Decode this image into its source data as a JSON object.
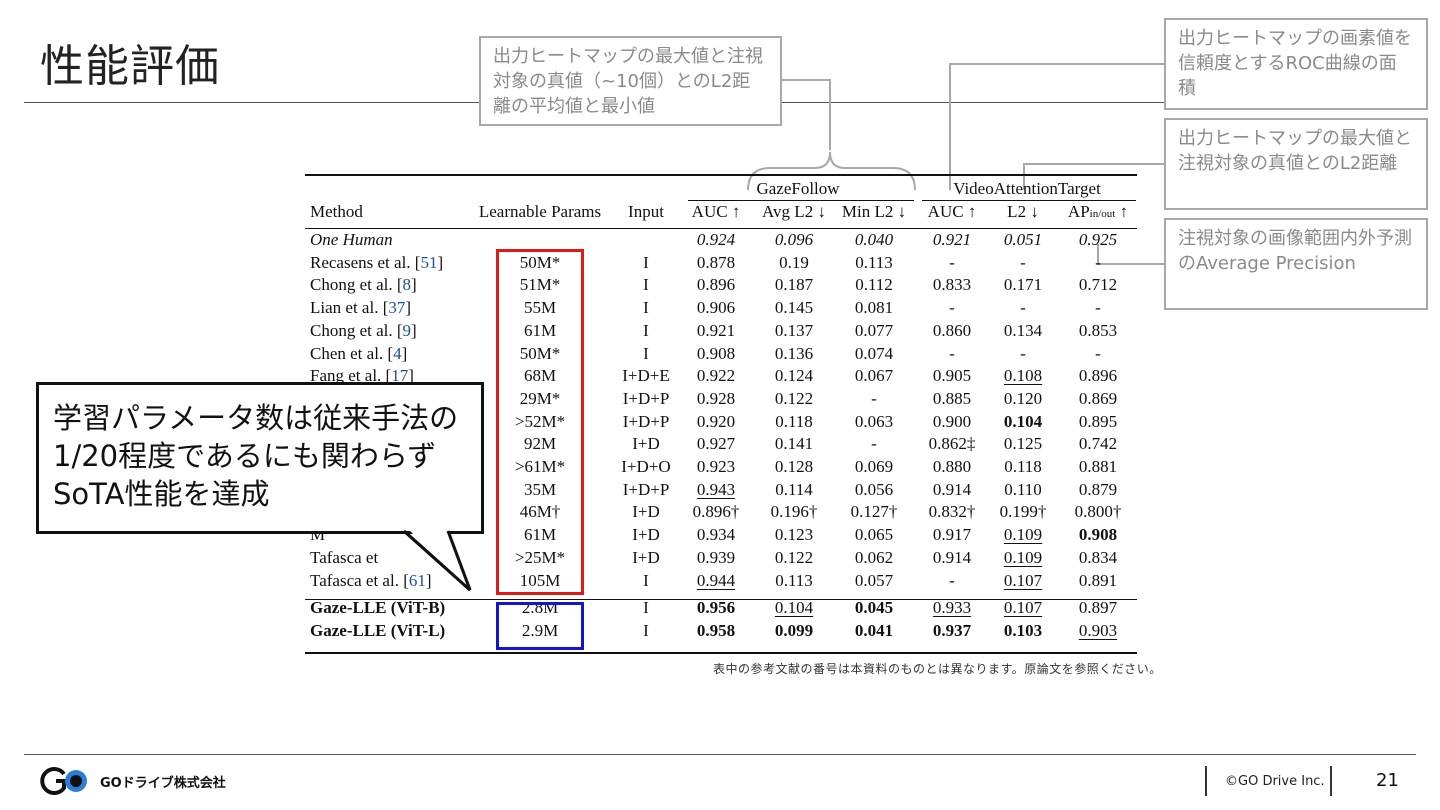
{
  "slide": {
    "title": "性能評価",
    "page_number": "21",
    "copyright": "©GO Drive Inc.",
    "logo_text": "GOドライブ株式会社",
    "note": "表中の参考文献の番号は本資料のものとは異なります。原論文を参照ください。"
  },
  "callouts": {
    "gazefollow_l2": "出力ヒートマップの最大値と注視対象の真値（~10個）とのL2距離の平均値と最小値",
    "auc": "出力ヒートマップの画素値を信頼度とするROC曲線の面積",
    "vat_l2": "出力ヒートマップの最大値と注視対象の真値とのL2距離",
    "ap": "注視対象の画像範囲内外予測のAverage Precision",
    "speech": "学習パラメータ数は従来手法の1/20程度であるにも関わらずSoTA性能を達成"
  },
  "table": {
    "group_gazefollow": "GazeFollow",
    "group_vat": "VideoAttentionTarget",
    "headers": [
      "Method",
      "Learnable Params",
      "Input",
      "AUC ↑",
      "Avg L2 ↓",
      "Min L2 ↓",
      "AUC ↑",
      "L2 ↓",
      "AP"
    ],
    "ap_sub": "in/out",
    "ap_arrow": "↑",
    "rows": [
      {
        "method": "One Human",
        "ref": "",
        "params": "",
        "input": "",
        "v": [
          "0.924",
          "0.096",
          "0.040",
          "0.921",
          "0.051",
          "0.925"
        ],
        "italic": true
      },
      {
        "method": "Recasens et al. [",
        "ref": "51",
        "params": "50M*",
        "input": "I",
        "v": [
          "0.878",
          "0.19",
          "0.113",
          "-",
          "-",
          "-"
        ]
      },
      {
        "method": "Chong et al. [",
        "ref": "8",
        "params": "51M*",
        "input": "I",
        "v": [
          "0.896",
          "0.187",
          "0.112",
          "0.833",
          "0.171",
          "0.712"
        ]
      },
      {
        "method": "Lian et al. [",
        "ref": "37",
        "params": "55M",
        "input": "I",
        "v": [
          "0.906",
          "0.145",
          "0.081",
          "-",
          "-",
          "-"
        ]
      },
      {
        "method": "Chong et al. [",
        "ref": "9",
        "params": "61M",
        "input": "I",
        "v": [
          "0.921",
          "0.137",
          "0.077",
          "0.860",
          "0.134",
          "0.853"
        ]
      },
      {
        "method": "Chen et al. [",
        "ref": "4",
        "params": "50M*",
        "input": "I",
        "v": [
          "0.908",
          "0.136",
          "0.074",
          "-",
          "-",
          "-"
        ]
      },
      {
        "method": "Fang et al. [",
        "ref": "17",
        "params": "68M",
        "input": "I+D+E",
        "v": [
          "0.922",
          "0.124",
          "0.067",
          "0.905",
          "0.108",
          "0.896"
        ]
      },
      {
        "method": "",
        "ref": "",
        "params": "29M*",
        "input": "I+D+P",
        "v": [
          "0.928",
          "0.122",
          "-",
          "0.885",
          "0.120",
          "0.869"
        ]
      },
      {
        "method": "",
        "ref": "",
        "params": ">52M*",
        "input": "I+D+P",
        "v": [
          "0.920",
          "0.118",
          "0.063",
          "0.900",
          "0.104",
          "0.895"
        ]
      },
      {
        "method": "",
        "ref": "",
        "params": "92M",
        "input": "I+D",
        "v": [
          "0.927",
          "0.141",
          "-",
          "0.862‡",
          "0.125",
          "0.742"
        ]
      },
      {
        "method": "",
        "ref": "",
        "params": ">61M*",
        "input": "I+D+O",
        "v": [
          "0.923",
          "0.128",
          "0.069",
          "0.880",
          "0.118",
          "0.881"
        ]
      },
      {
        "method": "",
        "ref": "",
        "params": "35M",
        "input": "I+D+P",
        "v": [
          "0.943",
          "0.114",
          "0.056",
          "0.914",
          "0.110",
          "0.879"
        ]
      },
      {
        "method": "",
        "ref": "",
        "params": "46M†",
        "input": "I+D",
        "v": [
          "0.896†",
          "0.196†",
          "0.127†",
          "0.832†",
          "0.199†",
          "0.800†"
        ]
      },
      {
        "method": "M",
        "ref": "",
        "params": "61M",
        "input": "I+D",
        "v": [
          "0.934",
          "0.123",
          "0.065",
          "0.917",
          "0.109",
          "0.908"
        ]
      },
      {
        "method": "Tafasca et",
        "ref": "",
        "params": ">25M*",
        "input": "I+D",
        "v": [
          "0.939",
          "0.122",
          "0.062",
          "0.914",
          "0.109",
          "0.834"
        ]
      },
      {
        "method": "Tafasca et al. [",
        "ref": "61",
        "params": "105M",
        "input": "I",
        "v": [
          "0.944",
          "0.113",
          "0.057",
          "-",
          "0.107",
          "0.891"
        ]
      },
      {
        "method": "Gaze-LLE (ViT-B)",
        "ref": "",
        "params": "2.8M",
        "input": "I",
        "v": [
          "0.956",
          "0.104",
          "0.045",
          "0.933",
          "0.107",
          "0.897"
        ],
        "bold": true
      },
      {
        "method": "Gaze-LLE (ViT-L)",
        "ref": "",
        "params": "2.9M",
        "input": "I",
        "v": [
          "0.958",
          "0.099",
          "0.041",
          "0.937",
          "0.103",
          "0.903"
        ],
        "bold": true
      }
    ]
  }
}
